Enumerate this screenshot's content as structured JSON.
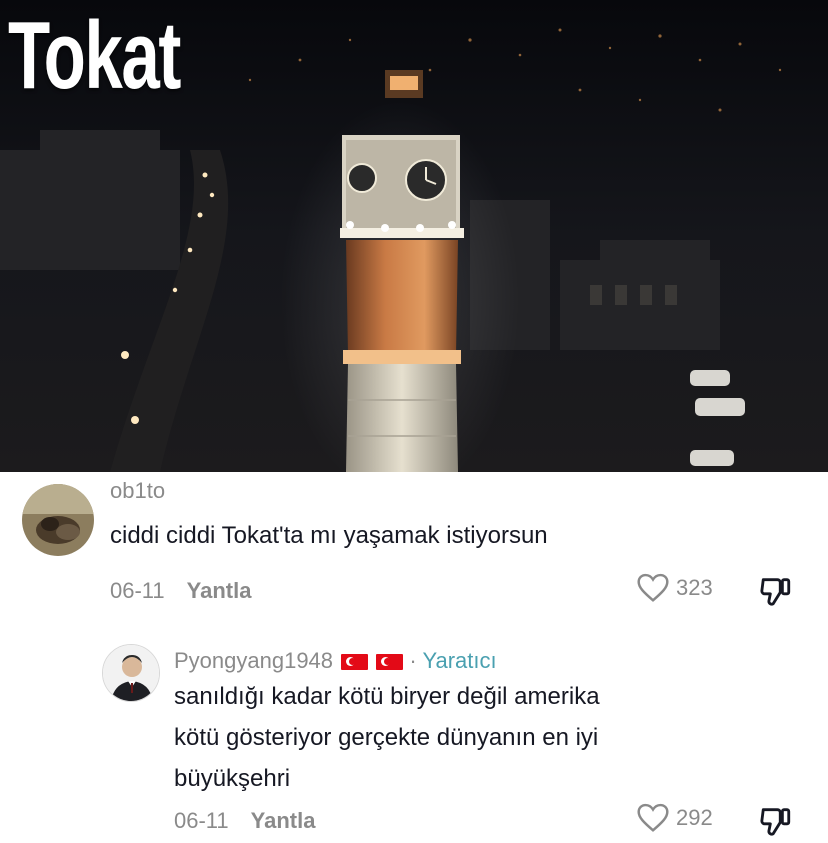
{
  "video": {
    "overlay_title": "Tokat"
  },
  "comments": [
    {
      "username": "ob1to",
      "text": "ciddi ciddi Tokat'ta mı yaşamak istiyorsun",
      "date": "06-11",
      "reply_label": "Yantla",
      "likes": "323",
      "avatar_icon": "dog-avatar"
    }
  ],
  "reply": {
    "username": "Pyongyang1948",
    "flags": [
      "turkey-flag",
      "turkey-flag"
    ],
    "separator": "·",
    "creator_label": "Yaratıcı",
    "text_lines": [
      "sanıldığı kadar kötü biryer değil amerika",
      "kötü gösteriyor gerçekte dünyanın en iyi",
      "büyükşehri"
    ],
    "date": "06-11",
    "reply_label": "Yantla",
    "likes": "292",
    "avatar_icon": "man-in-suit-avatar"
  },
  "colors": {
    "text_primary": "#161823",
    "text_secondary": "#8a8a8a",
    "creator_accent": "#4aa0b0"
  }
}
